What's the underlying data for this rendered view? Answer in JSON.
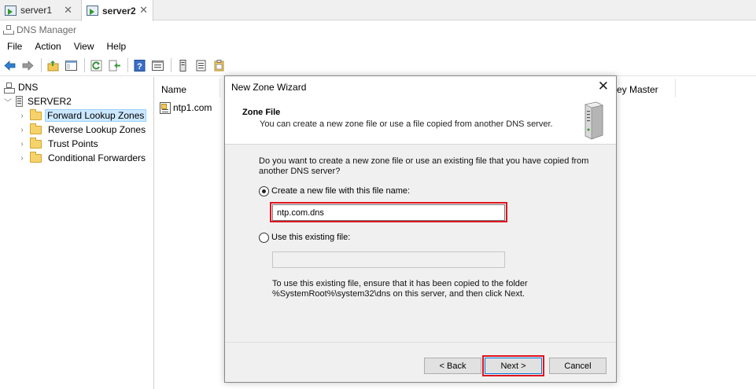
{
  "vm_tabs": [
    {
      "label": "server1",
      "active": false,
      "close": "✕"
    },
    {
      "label": "server2",
      "active": true,
      "close": "✕"
    }
  ],
  "app": {
    "title": "DNS Manager"
  },
  "menu": [
    "File",
    "Action",
    "View",
    "Help"
  ],
  "toolbar": {
    "buttons": [
      "back-icon",
      "forward-icon",
      "up-folder-icon",
      "show-hide-tree-icon",
      "refresh-icon",
      "export-list-icon",
      "help-icon",
      "properties-icon",
      "server-icon",
      "list-icon",
      "clipboard-icon"
    ]
  },
  "tree": {
    "root": "DNS",
    "server": "SERVER2",
    "items": [
      {
        "label": "Forward Lookup Zones",
        "selected": true
      },
      {
        "label": "Reverse Lookup Zones",
        "selected": false
      },
      {
        "label": "Trust Points",
        "selected": false
      },
      {
        "label": "Conditional Forwarders",
        "selected": false
      }
    ]
  },
  "list": {
    "columns": [
      "Name",
      "ey Master"
    ],
    "items": [
      "ntp1.com"
    ]
  },
  "dialog": {
    "title": "New Zone Wizard",
    "close": "✕",
    "header_title": "Zone File",
    "header_subtitle": "You can create a new zone file or use a file copied from another DNS server.",
    "question": "Do you want to create a new zone file or use an existing file that you have copied from another DNS server?",
    "option_new": "Create a new file with this file name:",
    "option_new_selected": true,
    "new_file_value": "ntp.com.dns",
    "option_existing": "Use this existing file:",
    "existing_file_value": "",
    "note": "To use this existing file, ensure that it has been copied to the folder %SystemRoot%\\system32\\dns on this server, and then click Next.",
    "buttons": {
      "back": "< Back",
      "next": "Next >",
      "cancel": "Cancel"
    },
    "highlight_color": "#e0141e"
  }
}
